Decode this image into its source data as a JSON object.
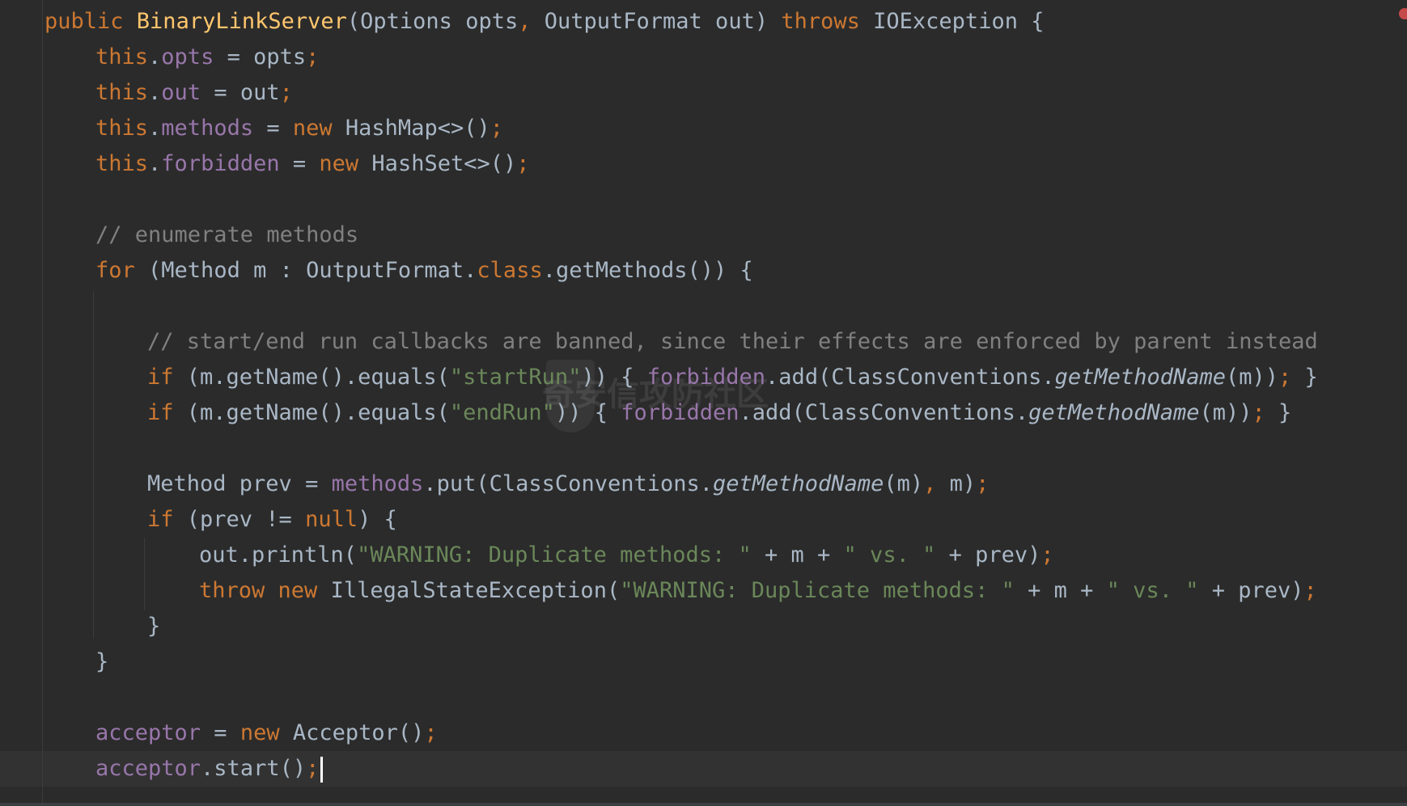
{
  "editor": {
    "colors": {
      "background": "#2b2b2b",
      "keyword": "#cc7832",
      "method_decl": "#ffc66d",
      "field": "#9876aa",
      "string": "#6a8759",
      "comment": "#808080",
      "plain": "#a9b7c6"
    },
    "watermark": "奇安信攻防社区",
    "lines": {
      "l1": {
        "kw": "public ",
        "fn": "BinaryLinkServer",
        "a": "(Options opts",
        "p1": ",",
        "b": " OutputFormat out) ",
        "kw2": "throws",
        "c": " IOException {"
      },
      "l2": {
        "kw": "this",
        "a": ".",
        "field": "opts",
        "b": " = opts",
        "p": ";"
      },
      "l3": {
        "kw": "this",
        "a": ".",
        "field": "out",
        "b": " = out",
        "p": ";"
      },
      "l4": {
        "kw": "this",
        "a": ".",
        "field": "methods",
        "b": " = ",
        "kw2": "new",
        "c": " HashMap<>()",
        "p": ";"
      },
      "l5": {
        "kw": "this",
        "a": ".",
        "field": "forbidden",
        "b": " = ",
        "kw2": "new",
        "c": " HashSet<>()",
        "p": ";"
      },
      "l7": {
        "cm": "// enumerate methods"
      },
      "l8": {
        "kw": "for",
        "a": " (Method m : OutputFormat.",
        "kw2": "class",
        "b": ".getMethods()) {"
      },
      "l10": {
        "cm": "// start/end run callbacks are banned, since their effects are enforced by parent instead"
      },
      "l11": {
        "kw": "if",
        "a": " (m.getName().equals(",
        "str": "\"startRun\"",
        "b": ")) { ",
        "field": "forbidden",
        "c": ".add(ClassConventions.",
        "it": "getMethodName",
        "d": "(m))",
        "p": ";",
        "e": " }"
      },
      "l12": {
        "kw": "if",
        "a": " (m.getName().equals(",
        "str": "\"endRun\"",
        "b": ")) { ",
        "field": "forbidden",
        "c": ".add(ClassConventions.",
        "it": "getMethodName",
        "d": "(m))",
        "p": ";",
        "e": " }"
      },
      "l14": {
        "a": "Method prev = ",
        "field": "methods",
        "b": ".put(ClassConventions.",
        "it": "getMethodName",
        "c": "(m)",
        "p1": ",",
        "d": " m)",
        "p": ";"
      },
      "l15": {
        "kw": "if",
        "a": " (prev != ",
        "kw2": "null",
        "b": ") {"
      },
      "l16": {
        "a": "out.println(",
        "str": "\"WARNING: Duplicate methods: \"",
        "b": " + m + ",
        "str2": "\" vs. \"",
        "c": " + prev)",
        "p": ";"
      },
      "l17": {
        "kw": "throw",
        "a": " ",
        "kw2": "new",
        "b": " IllegalStateException(",
        "str": "\"WARNING: Duplicate methods: \"",
        "c": " + m + ",
        "str2": "\" vs. \"",
        "d": " + prev)",
        "p": ";"
      },
      "l18": {
        "a": "}"
      },
      "l19": {
        "a": "}"
      },
      "l21": {
        "field": "acceptor",
        "a": " = ",
        "kw": "new",
        "b": " Acceptor()",
        "p": ";"
      },
      "l22": {
        "field": "acceptor",
        "a": ".start()",
        "p": ";"
      }
    }
  }
}
